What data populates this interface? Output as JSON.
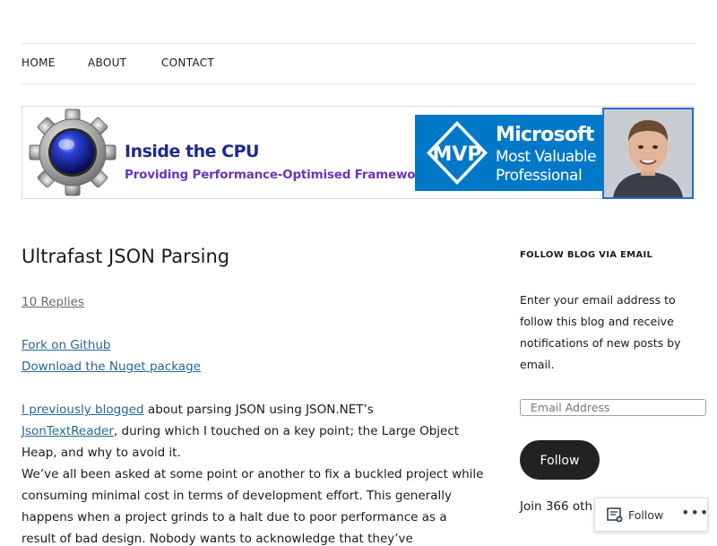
{
  "nav": {
    "items": [
      "HOME",
      "ABOUT",
      "CONTACT"
    ]
  },
  "banner": {
    "title": "Inside the CPU",
    "subtitle": "Providing Performance-Optimised Frameworks",
    "mvp": {
      "logo": "MVP",
      "line1": "Microsoft",
      "line2": "Most Valuable",
      "line3": "Professional"
    },
    "colors": {
      "mvp_blue": "#0078C8",
      "title_blue": "#1F2A8A",
      "subtitle_purple": "#6B35B8"
    }
  },
  "post": {
    "title": "Ultrafast JSON Parsing",
    "replies": "10 Replies",
    "link_github": "Fork on Github",
    "link_nuget": "Download the Nuget package",
    "p1_link": "I previously blogged",
    "p1_a": " about parsing JSON using JSON.NET’s",
    "p1_link2": "JsonTextReader",
    "p1_b": ", during which I touched on a key point; the Large Object",
    "p1_c": "Heap, and why to avoid it.",
    "p2_l1": "We’ve all been asked at some point or another to fix a buckled project while",
    "p2_l2": "consuming minimal cost in terms of development effort. This generally",
    "p2_l3": "happens when a project grinds to a halt due to poor performance as a",
    "p2_l4": "result of bad design. Nobody wants to acknowledge that they’ve"
  },
  "sidebar": {
    "heading": "FOLLOW BLOG VIA EMAIL",
    "desc": [
      "Enter your email address to",
      "follow this blog and receive",
      "notifications of new posts by",
      "email."
    ],
    "email_placeholder": "Email Address",
    "follow_label": "Follow",
    "join_text": "Join 366 oth"
  },
  "follow_bar": {
    "label": "Follow",
    "more": "•••"
  }
}
